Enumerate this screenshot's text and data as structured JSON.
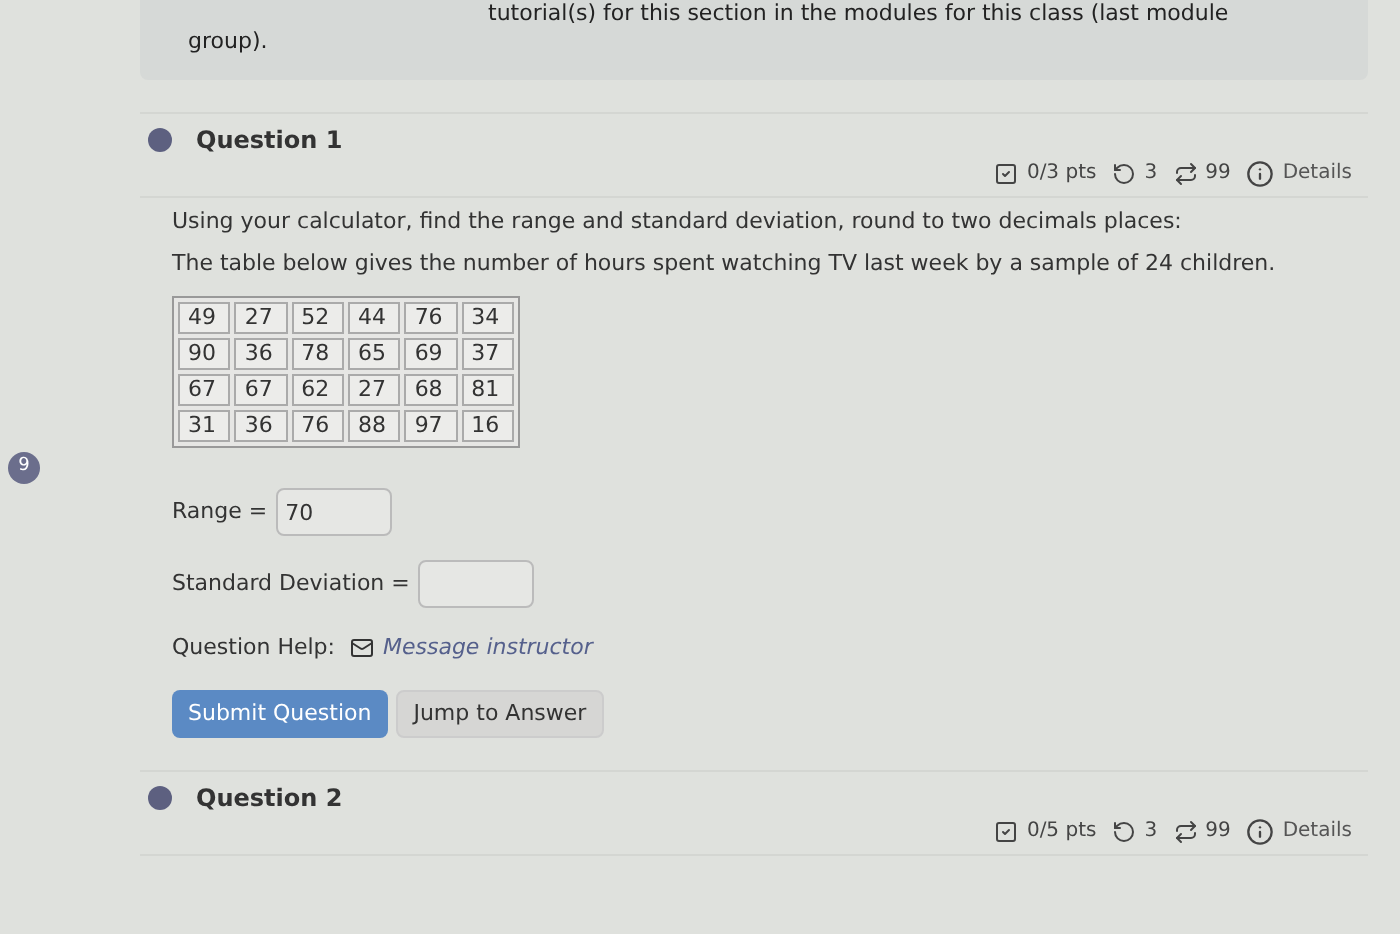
{
  "intro": {
    "lines": [
      "tutorial(s) for this section in the modules for this class (last module",
      "group)."
    ]
  },
  "side_badge": "9",
  "questions": [
    {
      "title": "Question 1",
      "pts": "0/3 pts",
      "retries": "3",
      "attempts": "99",
      "details": "Details"
    },
    {
      "title": "Question 2",
      "pts": "0/5 pts",
      "retries": "3",
      "attempts": "99",
      "details": "Details"
    }
  ],
  "body": {
    "instruction": "Using your calculator, find the range and standard deviation, round to two decimals places:",
    "description": "The table below gives the number of hours spent watching TV last week by a sample of 24 children.",
    "table": [
      [
        "49",
        "27",
        "52",
        "44",
        "76",
        "34"
      ],
      [
        "90",
        "36",
        "78",
        "65",
        "69",
        "37"
      ],
      [
        "67",
        "67",
        "62",
        "27",
        "68",
        "81"
      ],
      [
        "31",
        "36",
        "76",
        "88",
        "97",
        "16"
      ]
    ],
    "fields": [
      {
        "label": "Range =",
        "value": "70"
      },
      {
        "label": "Standard Deviation ="
      }
    ],
    "help_label": "Question Help:",
    "help_link": "Message instructor",
    "buttons": [
      {
        "label": "Submit Question",
        "kind": "primary"
      },
      {
        "label": "Jump to Answer",
        "kind": "secondary"
      }
    ]
  }
}
